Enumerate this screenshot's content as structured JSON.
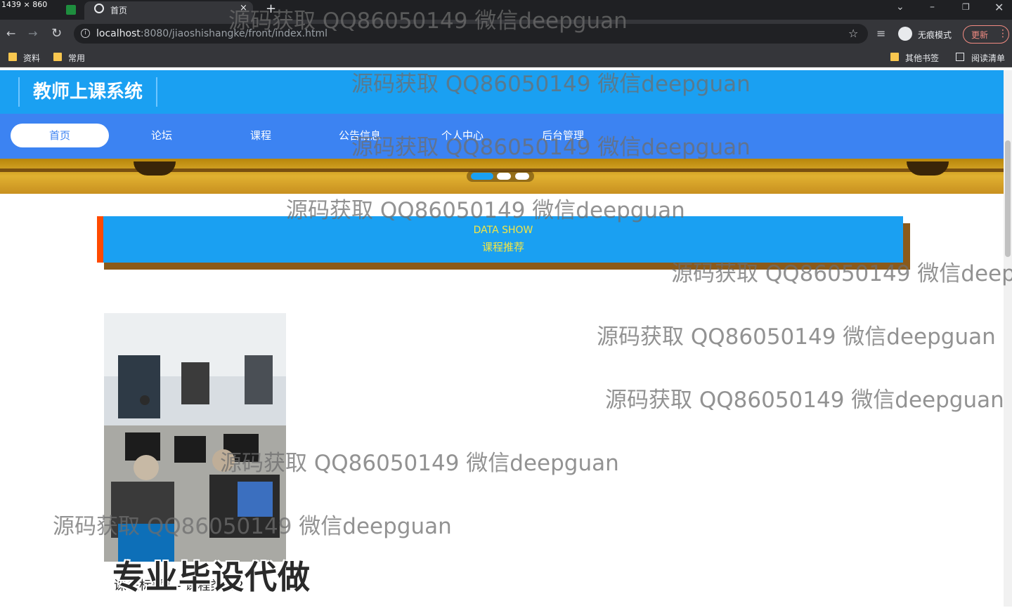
{
  "browser": {
    "dimensions_label": "1439 × 860",
    "tab_title": "首页",
    "tab_close": "×",
    "new_tab": "+",
    "url_host": "localhost",
    "url_path": ":8080/jiaoshishangke/front/index.html",
    "incognito_label": "无痕模式",
    "update_label": "更新",
    "bookmarks": [
      "资料",
      "常用"
    ],
    "other_bookmarks": "其他书签",
    "reading_list": "阅读清单"
  },
  "site": {
    "title": "教师上课系统",
    "nav": [
      "首页",
      "论坛",
      "课程",
      "公告信息",
      "个人中心",
      "后台管理"
    ],
    "active_nav": "首页"
  },
  "section": {
    "title_en": "DATA SHOW",
    "title_zh": "课程推荐"
  },
  "card": {
    "caption": "课程标题1 - 课程类型2"
  },
  "overlay_text": "专业毕设代做",
  "watermark": "源码获取 QQ86050149 微信deepguan",
  "colors": {
    "header": "#1aa0f2",
    "navbar": "#3c83f2",
    "section_accent": "#ff4a00",
    "section_text": "#f5e642"
  }
}
